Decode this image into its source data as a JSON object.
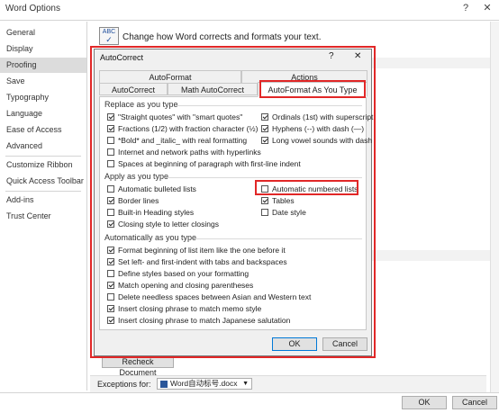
{
  "window": {
    "title": "Word Options",
    "help": "?",
    "close": "✕",
    "ok": "OK",
    "cancel": "Cancel"
  },
  "sidebar": {
    "items": [
      "General",
      "Display",
      "Proofing",
      "Save",
      "Typography",
      "Language",
      "Ease of Access",
      "Advanced",
      "Customize Ribbon",
      "Quick Access Toolbar",
      "Add-ins",
      "Trust Center"
    ],
    "selected": "Proofing"
  },
  "header": {
    "icon_text": "ABC",
    "text": "Change how Word corrects and formats your text."
  },
  "recheck": {
    "label": "Recheck Document"
  },
  "exceptions": {
    "label": "Exceptions for:",
    "value": "Word自动标号.docx"
  },
  "dialog": {
    "title": "AutoCorrect",
    "help": "?",
    "close": "✕",
    "tabs_top": [
      "AutoFormat",
      "Actions"
    ],
    "tabs_bottom": [
      "AutoCorrect",
      "Math AutoCorrect",
      "AutoFormat As You Type"
    ],
    "active_tab": "AutoFormat As You Type",
    "replace": {
      "label": "Replace as you type",
      "left": [
        {
          "text": "\"Straight quotes\" with \"smart quotes\"",
          "checked": true
        },
        {
          "text": "Fractions (1/2) with fraction character (½)",
          "checked": true
        },
        {
          "text": "*Bold* and _italic_ with real formatting",
          "checked": false
        },
        {
          "text": "Internet and network paths with hyperlinks",
          "checked": false
        },
        {
          "text": "Spaces at beginning of paragraph with first-line indent",
          "checked": false
        }
      ],
      "right": [
        {
          "text": "Ordinals (1st) with superscript",
          "checked": true
        },
        {
          "text": "Hyphens (--) with dash (—)",
          "checked": true
        },
        {
          "text": "Long vowel sounds with dash",
          "checked": true
        }
      ]
    },
    "apply": {
      "label": "Apply as you type",
      "left": [
        {
          "text": "Automatic bulleted lists",
          "checked": false
        },
        {
          "text": "Border lines",
          "checked": true
        },
        {
          "text": "Built-in Heading styles",
          "checked": false
        },
        {
          "text": "Closing style to letter closings",
          "checked": true
        }
      ],
      "right": [
        {
          "text": "Automatic numbered lists",
          "checked": false
        },
        {
          "text": "Tables",
          "checked": true
        },
        {
          "text": "Date style",
          "checked": false
        }
      ]
    },
    "auto": {
      "label": "Automatically as you type",
      "items": [
        {
          "text": "Format beginning of list item like the one before it",
          "checked": true
        },
        {
          "text": "Set left- and first-indent with tabs and backspaces",
          "checked": true
        },
        {
          "text": "Define styles based on your formatting",
          "checked": false
        },
        {
          "text": "Match opening and closing parentheses",
          "checked": true
        },
        {
          "text": "Delete needless spaces between Asian and Western text",
          "checked": false
        },
        {
          "text": "Insert closing phrase to match memo style",
          "checked": true
        },
        {
          "text": "Insert closing phrase to match Japanese salutation",
          "checked": true
        }
      ]
    },
    "ok": "OK",
    "cancel": "Cancel"
  },
  "colors": {
    "highlight": "#e12727",
    "selected_item": "#dcdcdc",
    "dialog_bg": "#f0f0f0"
  }
}
